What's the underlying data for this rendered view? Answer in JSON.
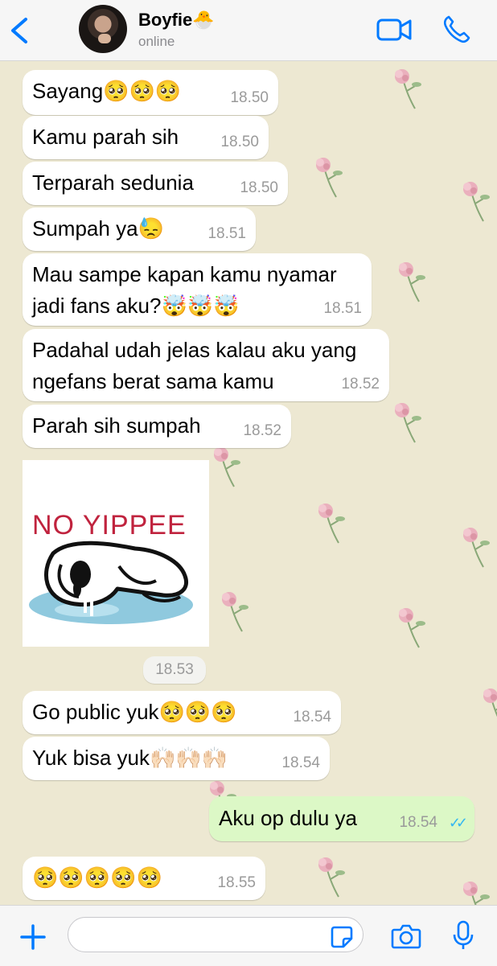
{
  "header": {
    "contact_name": "Boyfie🐣",
    "status": "online"
  },
  "messages": [
    {
      "text": "Sayang🥺🥺🥺",
      "time": "18.50"
    },
    {
      "text": "Kamu parah sih",
      "time": "18.50"
    },
    {
      "text": "Terparah sedunia",
      "time": "18.50"
    },
    {
      "text": "Sumpah ya😓",
      "time": "18.51"
    },
    {
      "line1": "Mau sampe kapan kamu nyamar",
      "line2": "jadi fans aku?🤯🤯🤯",
      "time": "18.51"
    },
    {
      "line1": "Padahal udah jelas kalau aku yang",
      "line2": "ngefans berat sama kamu",
      "time": "18.52"
    },
    {
      "text": "Parah sih sumpah",
      "time": "18.52"
    },
    {
      "text": "Go public yuk🥺🥺🥺",
      "time": "18.54"
    },
    {
      "text": "Yuk bisa yuk🙌🏻🙌🏻🙌🏻",
      "time": "18.54"
    },
    {
      "text": "Aku op dulu ya",
      "time": "18.54",
      "ticks": "✓✓"
    },
    {
      "text": "🥺🥺🥺🥺🥺",
      "time": "18.55"
    }
  ],
  "sticker": {
    "text": "NO YIPPEE",
    "time": "18.53"
  },
  "footer": {
    "input_placeholder": ""
  },
  "colors": {
    "accent": "#007aff",
    "outgoing_bubble": "#dcf8c6",
    "read_ticks": "#34b7f1",
    "wallpaper": "#ede8d2"
  }
}
